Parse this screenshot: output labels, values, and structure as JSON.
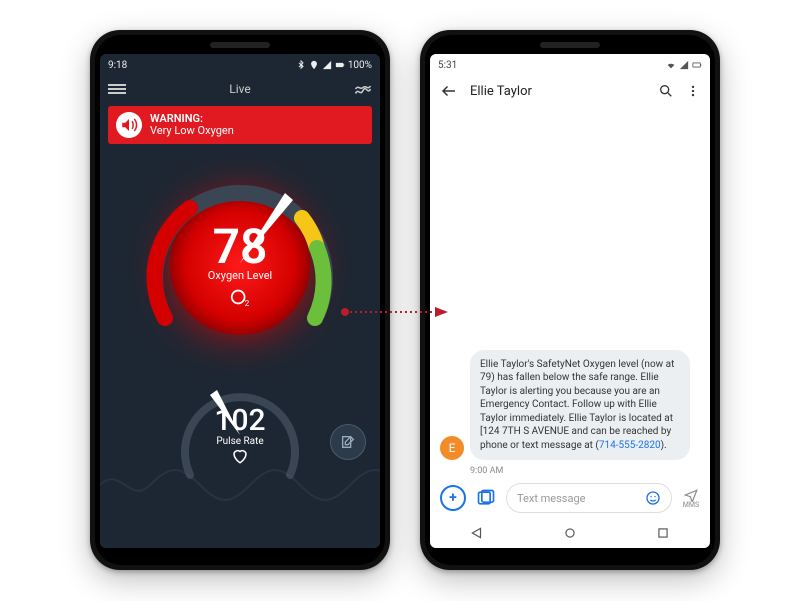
{
  "left_phone": {
    "status": {
      "time": "9:18",
      "battery": "100%"
    },
    "header": {
      "title": "Live"
    },
    "warning": {
      "title": "WARNING:",
      "message": "Very Low Oxygen"
    },
    "oxygen": {
      "value": "78",
      "label": "Oxygen Level"
    },
    "pulse": {
      "value": "102",
      "label": "Pulse Rate"
    }
  },
  "right_phone": {
    "status": {
      "time": "5:31"
    },
    "header": {
      "contact_name": "Ellie Taylor"
    },
    "avatar_initial": "E",
    "message": {
      "pre": "Ellie Taylor's SafetyNet Oxygen level (now at 79) has fallen below the safe range. Ellie Taylor is alerting you because you are an Emergency Contact. Follow up with Ellie Taylor immediately. Ellie Taylor is located at [124 7TH S AVENUE and can be reached by phone or text message at (",
      "phone_link": "714-555-2820",
      "post": ")."
    },
    "message_time": "9:00 AM",
    "composer": {
      "placeholder": "Text message",
      "send_sub": "MMS"
    }
  }
}
